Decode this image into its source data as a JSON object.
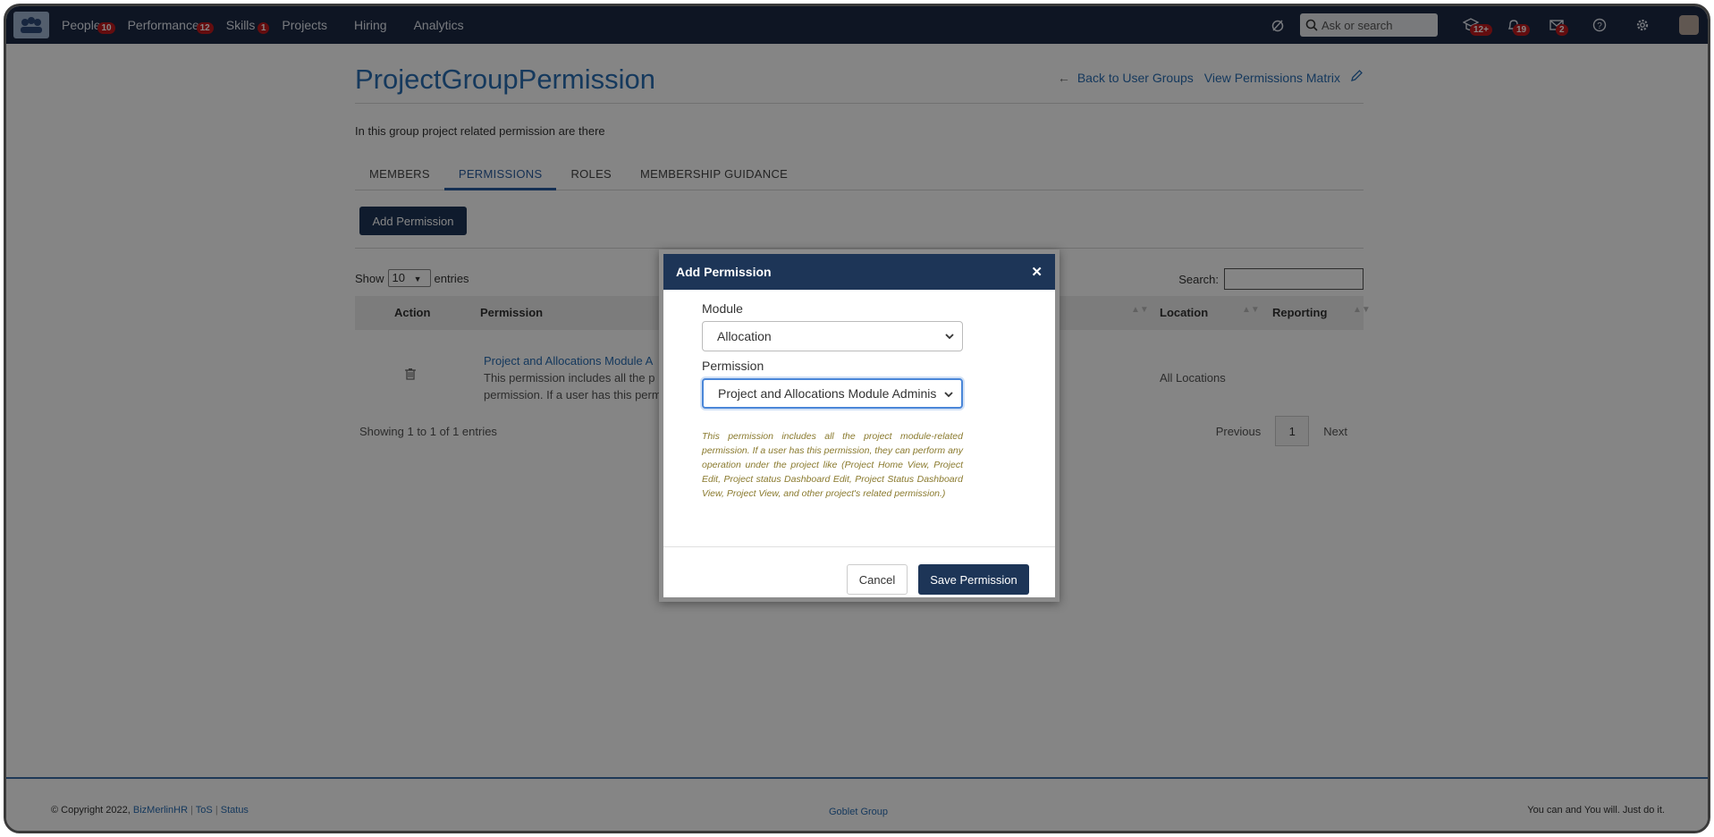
{
  "nav": {
    "items": [
      {
        "label": "People",
        "badge": "10"
      },
      {
        "label": "Performance",
        "badge": "12"
      },
      {
        "label": "Skills",
        "badge": "1"
      },
      {
        "label": "Projects",
        "badge": ""
      },
      {
        "label": "Hiring",
        "badge": ""
      },
      {
        "label": "Analytics",
        "badge": ""
      }
    ],
    "search_placeholder": "Ask or search",
    "badges": {
      "learning": "12+",
      "notifications": "19",
      "messages": "2"
    }
  },
  "page": {
    "title": "ProjectGroupPermission",
    "back_link": "Back to User Groups",
    "matrix_link": "View Permissions Matrix",
    "description": "In this group project related permission are there",
    "tabs": [
      "MEMBERS",
      "PERMISSIONS",
      "ROLES",
      "MEMBERSHIP GUIDANCE"
    ],
    "active_tab": "PERMISSIONS",
    "add_button": "Add Permission"
  },
  "table": {
    "show_label": "Show",
    "entries_label": "entries",
    "page_size": "10",
    "search_label": "Search:",
    "columns": [
      "Action",
      "Permission",
      "Location",
      "Reporting"
    ],
    "rows": [
      {
        "permission_title": "Project and Allocations Module A",
        "permission_desc_1": "This permission includes all the p",
        "permission_desc_2": "permission. If a user has this perm",
        "location": "All Locations",
        "reporting": ""
      }
    ],
    "info": "Showing 1 to 1 of 1 entries",
    "pagination": {
      "previous": "Previous",
      "current": "1",
      "next": "Next"
    }
  },
  "footer": {
    "copyright": "© Copyright 2022,",
    "brand": "BizMerlinHR",
    "tos": "ToS",
    "status": "Status",
    "center": "Goblet Group",
    "tagline": "You can and You will. Just do it."
  },
  "modal": {
    "title": "Add Permission",
    "module_label": "Module",
    "module_value": "Allocation",
    "permission_label": "Permission",
    "permission_value": "Project and Allocations Module Adminis",
    "help_text": "This permission includes all the project module-related permission. If a user has this permission, they can perform any operation under the project like (Project Home View, Project Edit, Project status Dashboard Edit, Project Status Dashboard View, Project View, and other project's related permission.)",
    "cancel": "Cancel",
    "save": "Save Permission"
  }
}
